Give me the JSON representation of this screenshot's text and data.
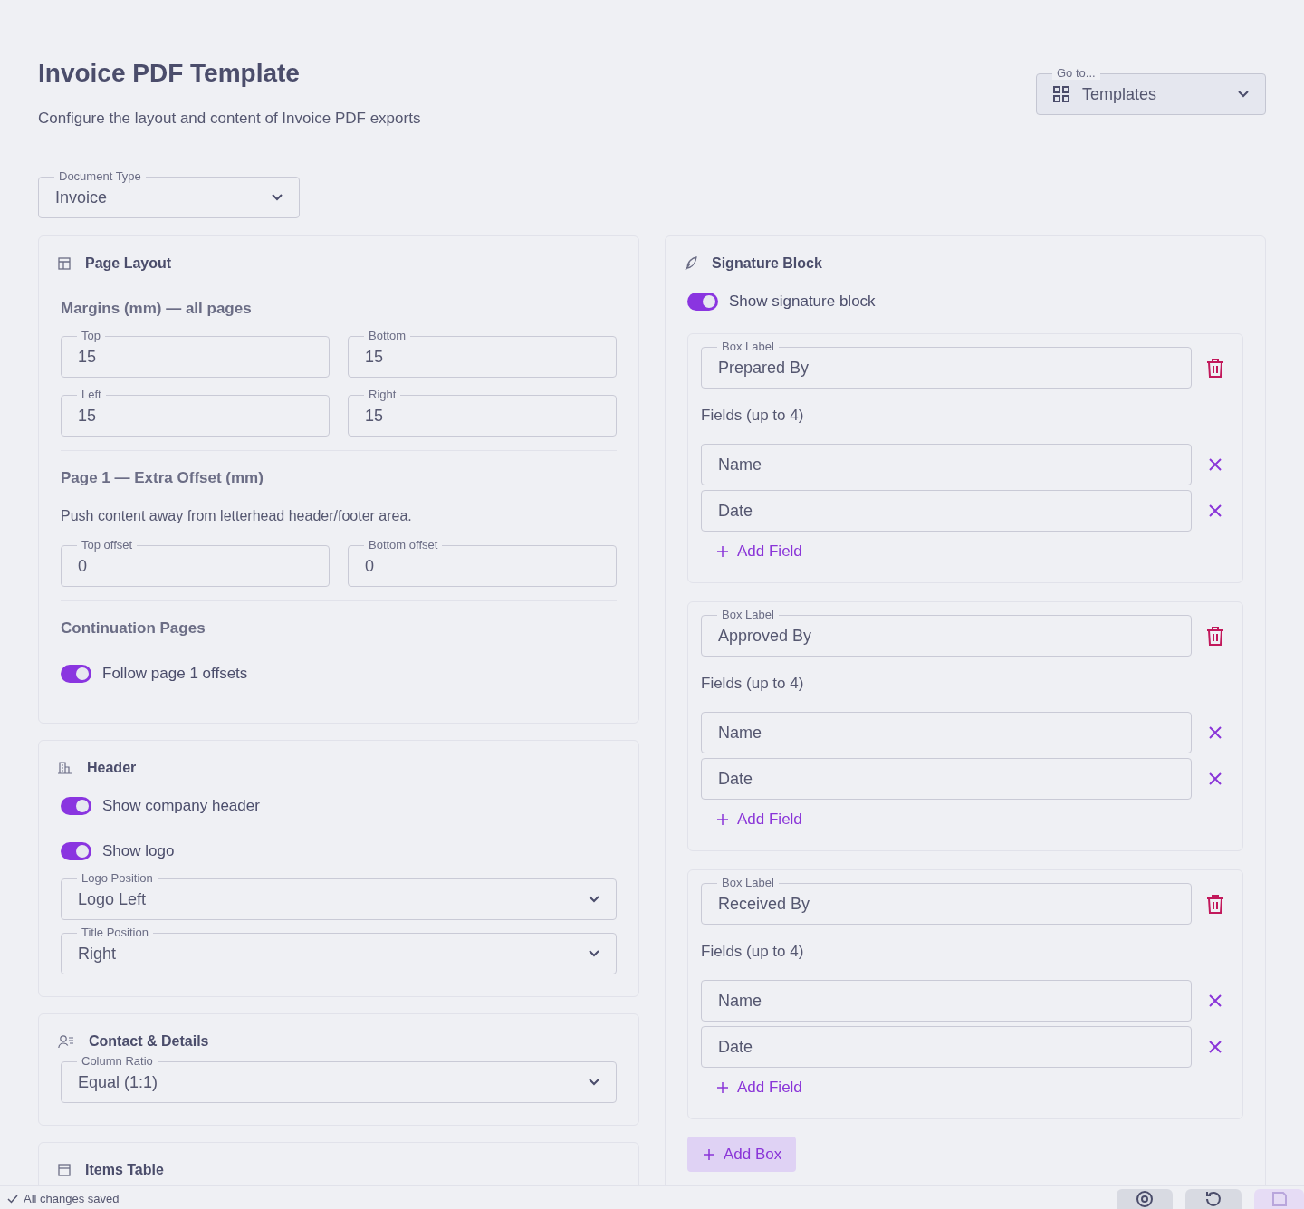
{
  "page": {
    "title": "Invoice PDF Template",
    "subtitle": "Configure the layout and content of Invoice PDF exports"
  },
  "goto": {
    "label": "Go to...",
    "value": "Templates"
  },
  "document_type": {
    "label": "Document Type",
    "value": "Invoice"
  },
  "page_layout": {
    "title": "Page Layout",
    "margins_heading": "Margins (mm) — all pages",
    "margins": [
      {
        "label": "Top",
        "value": "15"
      },
      {
        "label": "Bottom",
        "value": "15"
      },
      {
        "label": "Left",
        "value": "15"
      },
      {
        "label": "Right",
        "value": "15"
      }
    ],
    "page1_heading": "Page 1 — Extra Offset (mm)",
    "page1_description": "Push content away from letterhead header/footer area.",
    "offsets": [
      {
        "label": "Top offset",
        "value": "0"
      },
      {
        "label": "Bottom offset",
        "value": "0"
      }
    ],
    "continuation_heading": "Continuation Pages",
    "follow_toggle": {
      "label": "Follow page 1 offsets",
      "on": true
    }
  },
  "header": {
    "title": "Header",
    "toggles": [
      {
        "label": "Show company header",
        "on": true
      },
      {
        "label": "Show logo",
        "on": true
      }
    ],
    "selects": [
      {
        "label": "Logo Position",
        "value": "Logo Left"
      },
      {
        "label": "Title Position",
        "value": "Right"
      }
    ]
  },
  "contact": {
    "title": "Contact & Details",
    "select": {
      "label": "Column Ratio",
      "value": "Equal (1:1)"
    }
  },
  "items_table": {
    "title": "Items Table"
  },
  "signature": {
    "title": "Signature Block",
    "toggle": {
      "label": "Show signature block",
      "on": true
    },
    "boxes": [
      {
        "caption": "Box Label",
        "value": "Prepared By",
        "fields_heading": "Fields (up to 4)",
        "fields": [
          "Name",
          "Date"
        ],
        "add_field": "Add Field"
      },
      {
        "caption": "Box Label",
        "value": "Approved By",
        "fields_heading": "Fields (up to 4)",
        "fields": [
          "Name",
          "Date"
        ],
        "add_field": "Add Field"
      },
      {
        "caption": "Box Label",
        "value": "Received By",
        "fields_heading": "Fields (up to 4)",
        "fields": [
          "Name",
          "Date"
        ],
        "add_field": "Add Field"
      }
    ],
    "add_box": "Add Box"
  },
  "status_bar": {
    "text": "All changes saved"
  }
}
